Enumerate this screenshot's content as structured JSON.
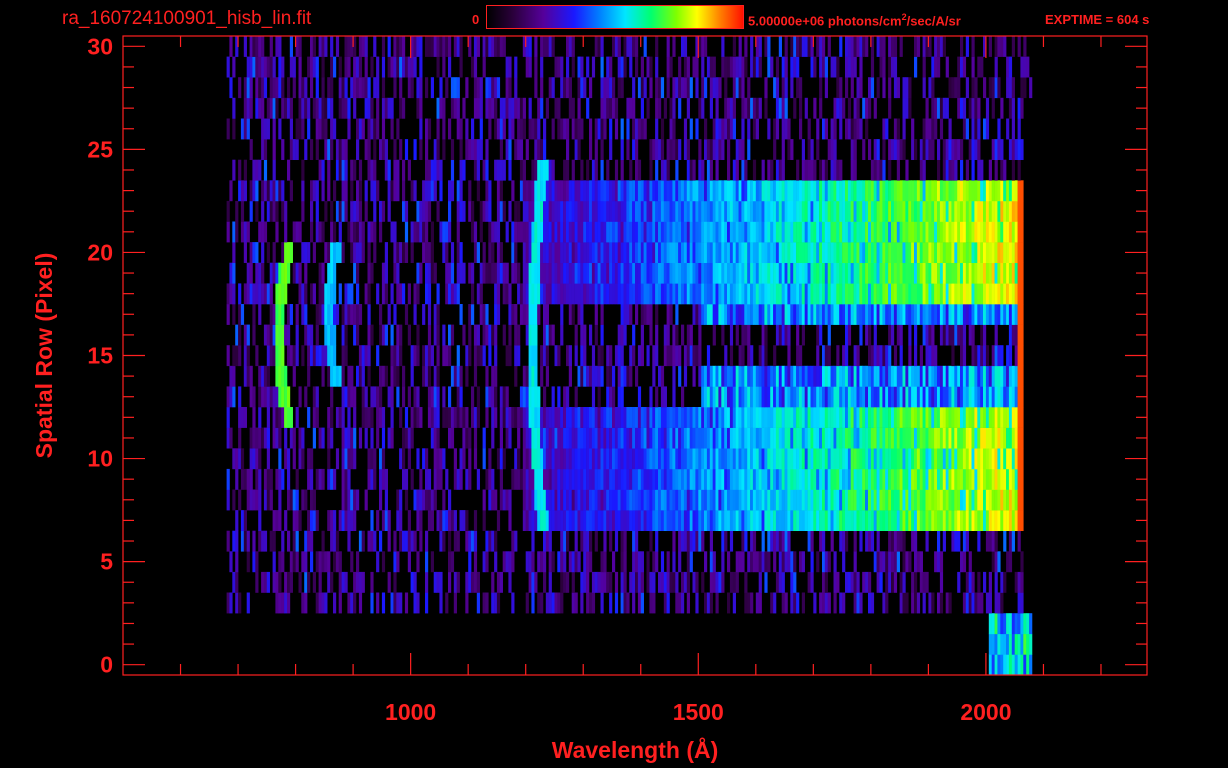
{
  "header": {
    "filename": "ra_160724100901_hisb_lin.fit",
    "colorbar_min": "0",
    "colorbar_max_value": "5.00000e+06 photons/cm",
    "colorbar_max_exp": "2",
    "colorbar_max_rest": "/sec/A/sr",
    "exptime": "EXPTIME = 604 s"
  },
  "chart_data": {
    "type": "heatmap",
    "title": "ra_160724100901_hisb_lin.fit",
    "xlabel": "Wavelength (Å)",
    "ylabel": "Spatial Row (Pixel)",
    "xlim": [
      500,
      2280
    ],
    "ylim": [
      -0.5,
      30.5
    ],
    "x_ticks": [
      1000,
      1500,
      2000
    ],
    "y_ticks": [
      0,
      5,
      10,
      15,
      20,
      25,
      30
    ],
    "x_tick_labels": [
      "1000",
      "1500",
      "2000"
    ],
    "y_tick_labels": [
      "0",
      "5",
      "10",
      "15",
      "20",
      "25",
      "30"
    ],
    "colorbar": {
      "min": 0,
      "max": 5000000,
      "units": "photons/cm^2/sec/A/sr",
      "colormap": "rainbow"
    },
    "signal_x_range": [
      680,
      2065
    ],
    "illuminated_rows": [
      {
        "rows": [
          7,
          12
        ],
        "start_x": 1195,
        "peak_level": 0.78
      },
      {
        "rows": [
          18,
          23
        ],
        "start_x": 1195,
        "peak_level": 0.8
      }
    ],
    "emission_lines": [
      {
        "name": "arc-line-1",
        "x": 770,
        "rows": [
          12,
          20
        ],
        "level": 0.7
      },
      {
        "name": "arc-line-2",
        "x": 855,
        "rows": [
          14,
          20
        ],
        "level": 0.5
      },
      {
        "name": "line-1216",
        "x": 1210,
        "rows": [
          7,
          24
        ],
        "level": 0.55
      }
    ],
    "edge_x": 2060,
    "exptime_s": 604
  },
  "colors": {
    "axis": "#ff2020",
    "background": "#000000"
  }
}
